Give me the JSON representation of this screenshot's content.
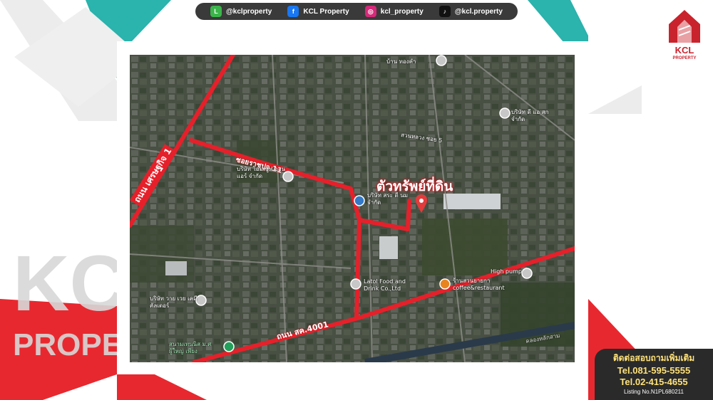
{
  "social": [
    {
      "icon": "line-icon",
      "label": "@kclproperty",
      "color": "#3bb54a",
      "glyph": "L"
    },
    {
      "icon": "facebook-icon",
      "label": "KCL Property",
      "color": "#1877f2",
      "glyph": "f"
    },
    {
      "icon": "instagram-icon",
      "label": "kcl_property",
      "color": "#d6297a",
      "glyph": "◎"
    },
    {
      "icon": "tiktok-icon",
      "label": "@kcl.property",
      "color": "#111111",
      "glyph": "♪"
    }
  ],
  "brand": {
    "name": "KCL",
    "sub": "PROPERTY",
    "color": "#c9232d"
  },
  "watermark": {
    "big": "KCL",
    "sub": "PROPERTY"
  },
  "map": {
    "property_label": "ตัวทรัพย์ที่ดิน",
    "roads": {
      "road1": "ถนน เศรษฐกิจ 1",
      "road2": "ซอยราชปุจ 11",
      "road3": "ถนน สค.4001"
    },
    "places": [
      {
        "label": "บริษัท โอม ซูฟ ออนแอร์ จำกัด"
      },
      {
        "label": "บริษัท สระ ดี นม จำกัด"
      },
      {
        "label": "Latol Food and Drink Co.,Ltd"
      },
      {
        "label": "ร้านสวนยายกา coffee&restaurant"
      },
      {
        "label": "High pump"
      },
      {
        "label": "บริษัท ดี แอ สก จำกัด"
      },
      {
        "label": "สวนหลวง ซอย 5"
      },
      {
        "label": "บริษัท วาย เวย เคมีคัลเตอร์"
      },
      {
        "label": "สนามเทนนิส ม.ศ ผู้ใหญ่ เพียง"
      },
      {
        "label": "คลองหลักสาม"
      },
      {
        "label": "บ้าน ทองคำ"
      }
    ]
  },
  "contact": {
    "line1": "ติดต่อสอบถามเพิ่มเติม",
    "tel1": "Tel.081-595-5555",
    "tel2": "Tel.02-415-4655",
    "listing": "Listing No.N1PL680211"
  },
  "colors": {
    "accent_red": "#e8282f",
    "accent_teal": "#2bb3ad",
    "road_red": "#e6202a"
  }
}
